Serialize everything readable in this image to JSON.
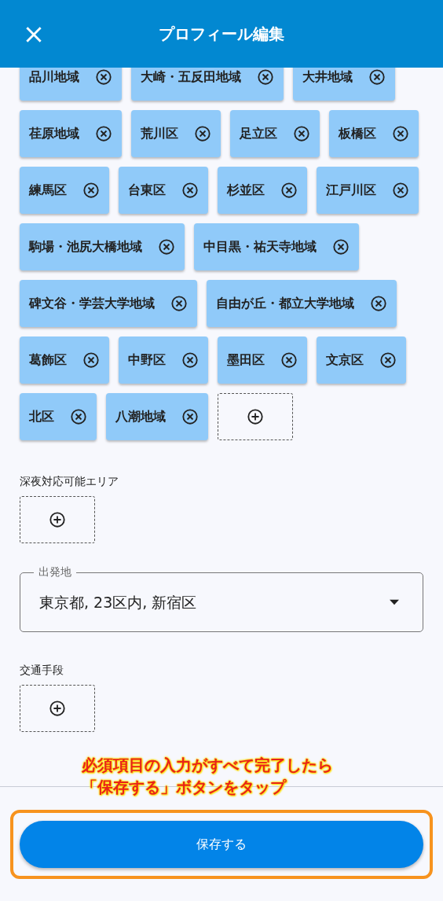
{
  "header": {
    "title": "プロフィール編集"
  },
  "areas": [
    {
      "label": "品川地域"
    },
    {
      "label": "大崎・五反田地域"
    },
    {
      "label": "大井地域"
    },
    {
      "label": "荏原地域"
    },
    {
      "label": "荒川区"
    },
    {
      "label": "足立区"
    },
    {
      "label": "板橋区"
    },
    {
      "label": "練馬区"
    },
    {
      "label": "台東区"
    },
    {
      "label": "杉並区"
    },
    {
      "label": "江戸川区"
    },
    {
      "label": "駒場・池尻大橋地域"
    },
    {
      "label": "中目黒・祐天寺地域"
    },
    {
      "label": "碑文谷・学芸大学地域"
    },
    {
      "label": "自由が丘・都立大学地域"
    },
    {
      "label": "葛飾区"
    },
    {
      "label": "中野区"
    },
    {
      "label": "墨田区"
    },
    {
      "label": "文京区"
    },
    {
      "label": "北区"
    },
    {
      "label": "八潮地域"
    }
  ],
  "late_night_areas": {
    "label": "深夜対応可能エリア"
  },
  "departure": {
    "label": "出発地",
    "value": "東京都, 23区内, 新宿区"
  },
  "transport": {
    "label": "交通手段"
  },
  "annotation": {
    "lines": [
      "必須項目の入力がすべて完了したら",
      "「保存する」ボタンをタップ"
    ]
  },
  "save_button": {
    "label": "保存する"
  }
}
